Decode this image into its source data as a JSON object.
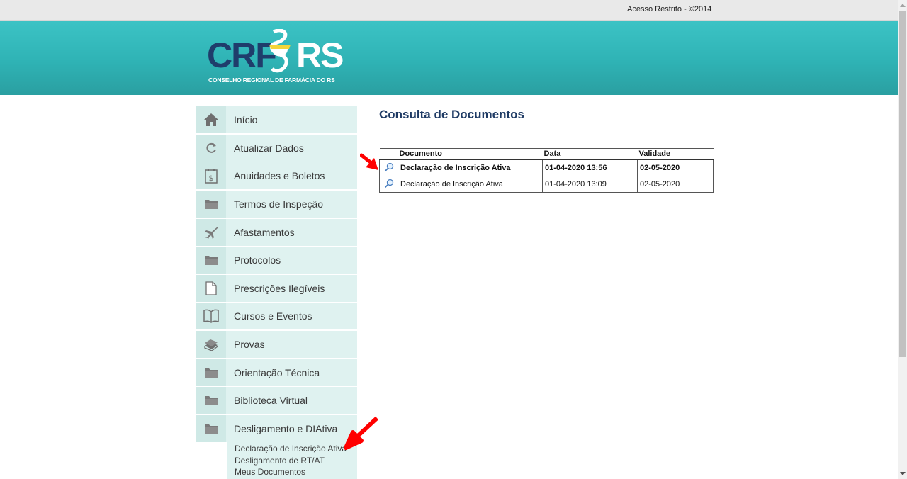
{
  "topbar": {
    "restricted_text": "Acesso Restrito - ©2014"
  },
  "logo": {
    "crf": "CRF",
    "rs": "RS",
    "subtitle": "CONSELHO REGIONAL DE FARMÁCIA DO RS"
  },
  "sidebar": {
    "items": [
      {
        "label": "Início",
        "icon": "home-icon"
      },
      {
        "label": "Atualizar Dados",
        "icon": "refresh-icon"
      },
      {
        "label": "Anuidades e Boletos",
        "icon": "calendar-dollar-icon"
      },
      {
        "label": "Termos de Inspeção",
        "icon": "folder-icon"
      },
      {
        "label": "Afastamentos",
        "icon": "airplane-icon"
      },
      {
        "label": "Protocolos",
        "icon": "folder-icon"
      },
      {
        "label": "Prescrições Ilegíveis",
        "icon": "document-icon"
      },
      {
        "label": "Cursos e Eventos",
        "icon": "book-icon"
      },
      {
        "label": "Provas",
        "icon": "books-stack-icon"
      },
      {
        "label": "Orientação Técnica",
        "icon": "folder-icon"
      },
      {
        "label": "Biblioteca Virtual",
        "icon": "folder-icon"
      },
      {
        "label": "Desligamento e DIAtiva",
        "icon": "folder-icon"
      }
    ],
    "submenu": [
      "Declaração de Inscrição Ativa",
      "Desligamento de RT/AT",
      "Meus Documentos"
    ]
  },
  "main": {
    "title": "Consulta de Documentos",
    "table": {
      "headers": [
        "Documento",
        "Data",
        "Validade"
      ],
      "rows": [
        {
          "documento": "Declaração de Inscrição Ativa",
          "data": "01-04-2020 13:56",
          "validade": "02-05-2020"
        },
        {
          "documento": "Declaração de Inscrição Ativa",
          "data": "01-04-2020 13:09",
          "validade": "02-05-2020"
        }
      ]
    }
  },
  "colors": {
    "header_teal": "#2fb3b5",
    "brand_navy": "#1f3d6b",
    "sidebar_bg": "#dff2f0",
    "annotation_arrow": "#ff0000"
  }
}
